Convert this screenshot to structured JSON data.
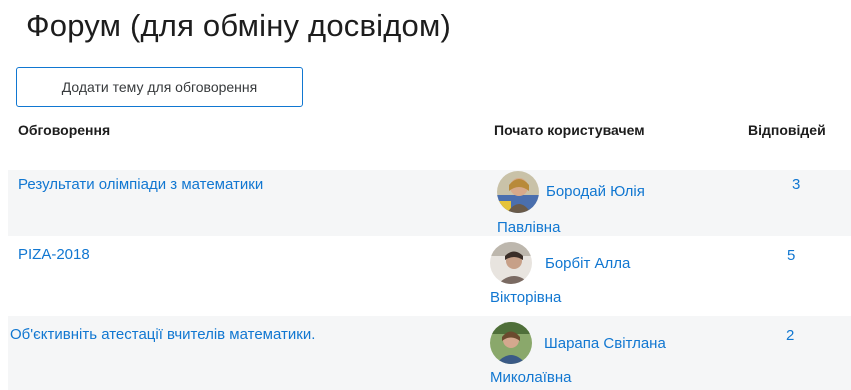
{
  "page": {
    "title": "Форум (для обміну досвідом)"
  },
  "add_topic_button": {
    "label": "Додати тему для обговорення"
  },
  "table": {
    "headers": {
      "topic": "Обговорення",
      "started_by": "Почато користувачем",
      "replies": "Відповідей"
    },
    "rows": [
      {
        "topic": "Результати олімпіади з математики",
        "author_first_line": "Бородай Юлія",
        "author_second_line": "Павлівна",
        "replies": "3"
      },
      {
        "topic": "PIZA-2018",
        "author_first_line": "Борбіт Алла",
        "author_second_line": "Вікторівна",
        "replies": "5"
      },
      {
        "topic": "Об'єктивніть атестації вчителів математики.",
        "author_first_line": "Шарапа Світлана",
        "author_second_line": "Миколаївна",
        "replies": "2"
      }
    ]
  },
  "colors": {
    "link": "#1177d1",
    "button_border": "#1177d1",
    "stripe": "#f5f6f7"
  }
}
